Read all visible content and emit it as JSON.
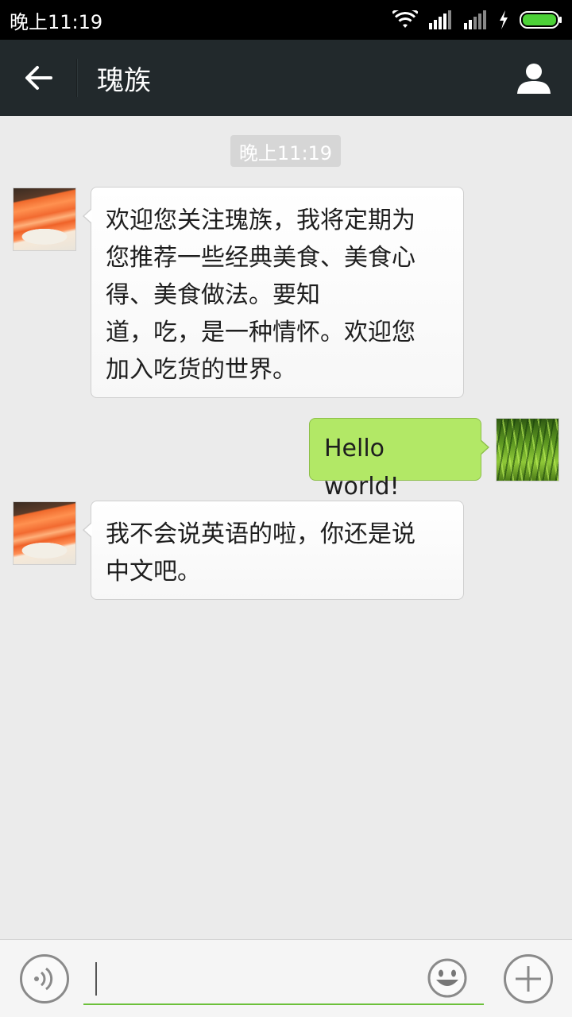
{
  "status_bar": {
    "time": "晚上11:19",
    "icons": [
      "wifi-icon",
      "signal-icon",
      "signal-icon",
      "charging-icon",
      "battery-icon"
    ],
    "battery_color": "#4cd137"
  },
  "header": {
    "title": "瑰族",
    "back_icon": "arrow-left-icon",
    "profile_icon": "person-icon",
    "background": "#22292c"
  },
  "chat": {
    "timestamp": "晚上11:19",
    "messages": [
      {
        "side": "incoming",
        "avatar": "sushi-avatar",
        "text": "欢迎您关注瑰族，我将定期为\n您推荐一些经典美食、美食心\n得、美食做法。要知\n道，吃，是一种情怀。欢迎您\n加入吃货的世界。"
      },
      {
        "side": "outgoing",
        "avatar": "grass-avatar",
        "text": "Hello world!"
      },
      {
        "side": "incoming",
        "avatar": "sushi-avatar",
        "text": "我不会说英语的啦，你还是说\n中文吧。"
      }
    ],
    "outgoing_bubble_color": "#b2e866"
  },
  "input_bar": {
    "value": "",
    "voice_icon": "voice-icon",
    "emoji_icon": "smiley-icon",
    "plus_icon": "plus-icon",
    "accent": "#6cc03a"
  }
}
